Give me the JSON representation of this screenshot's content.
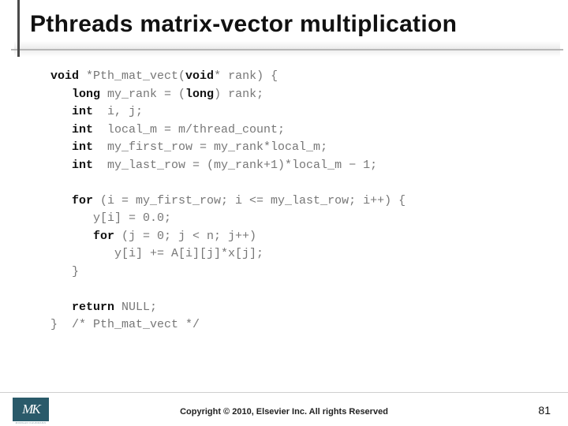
{
  "title": "Pthreads matrix-vector multiplication",
  "code": {
    "l1a": "void",
    "l1b": " *Pth_mat_vect(",
    "l1c": "void",
    "l1d": "* rank) {",
    "l2a": "   long",
    "l2b": " my_rank = (",
    "l2c": "long",
    "l2d": ") rank;",
    "l3a": "   int",
    "l3b": "  i, j;",
    "l4a": "   int",
    "l4b": "  local_m = m/thread_count;",
    "l5a": "   int",
    "l5b": "  my_first_row = my_rank*local_m;",
    "l6a": "   int",
    "l6b": "  my_last_row = (my_rank+1)*local_m − 1;",
    "blank1": "",
    "l7a": "   for",
    "l7b": " (i = my_first_row; i <= my_last_row; i++) {",
    "l8": "      y[i] = 0.0;",
    "l9a": "      for",
    "l9b": " (j = 0; j < n; j++)",
    "l10": "         y[i] += A[i][j]*x[j];",
    "l11": "   }",
    "blank2": "",
    "l12a": "   return",
    "l12b": " NULL;",
    "l13": "}  /* Pth_mat_vect */"
  },
  "footer": {
    "logo_text": "MK",
    "logo_sub": "MORGAN KAUFMANN",
    "copyright": "Copyright © 2010, Elsevier Inc. All rights Reserved",
    "page": "81"
  }
}
